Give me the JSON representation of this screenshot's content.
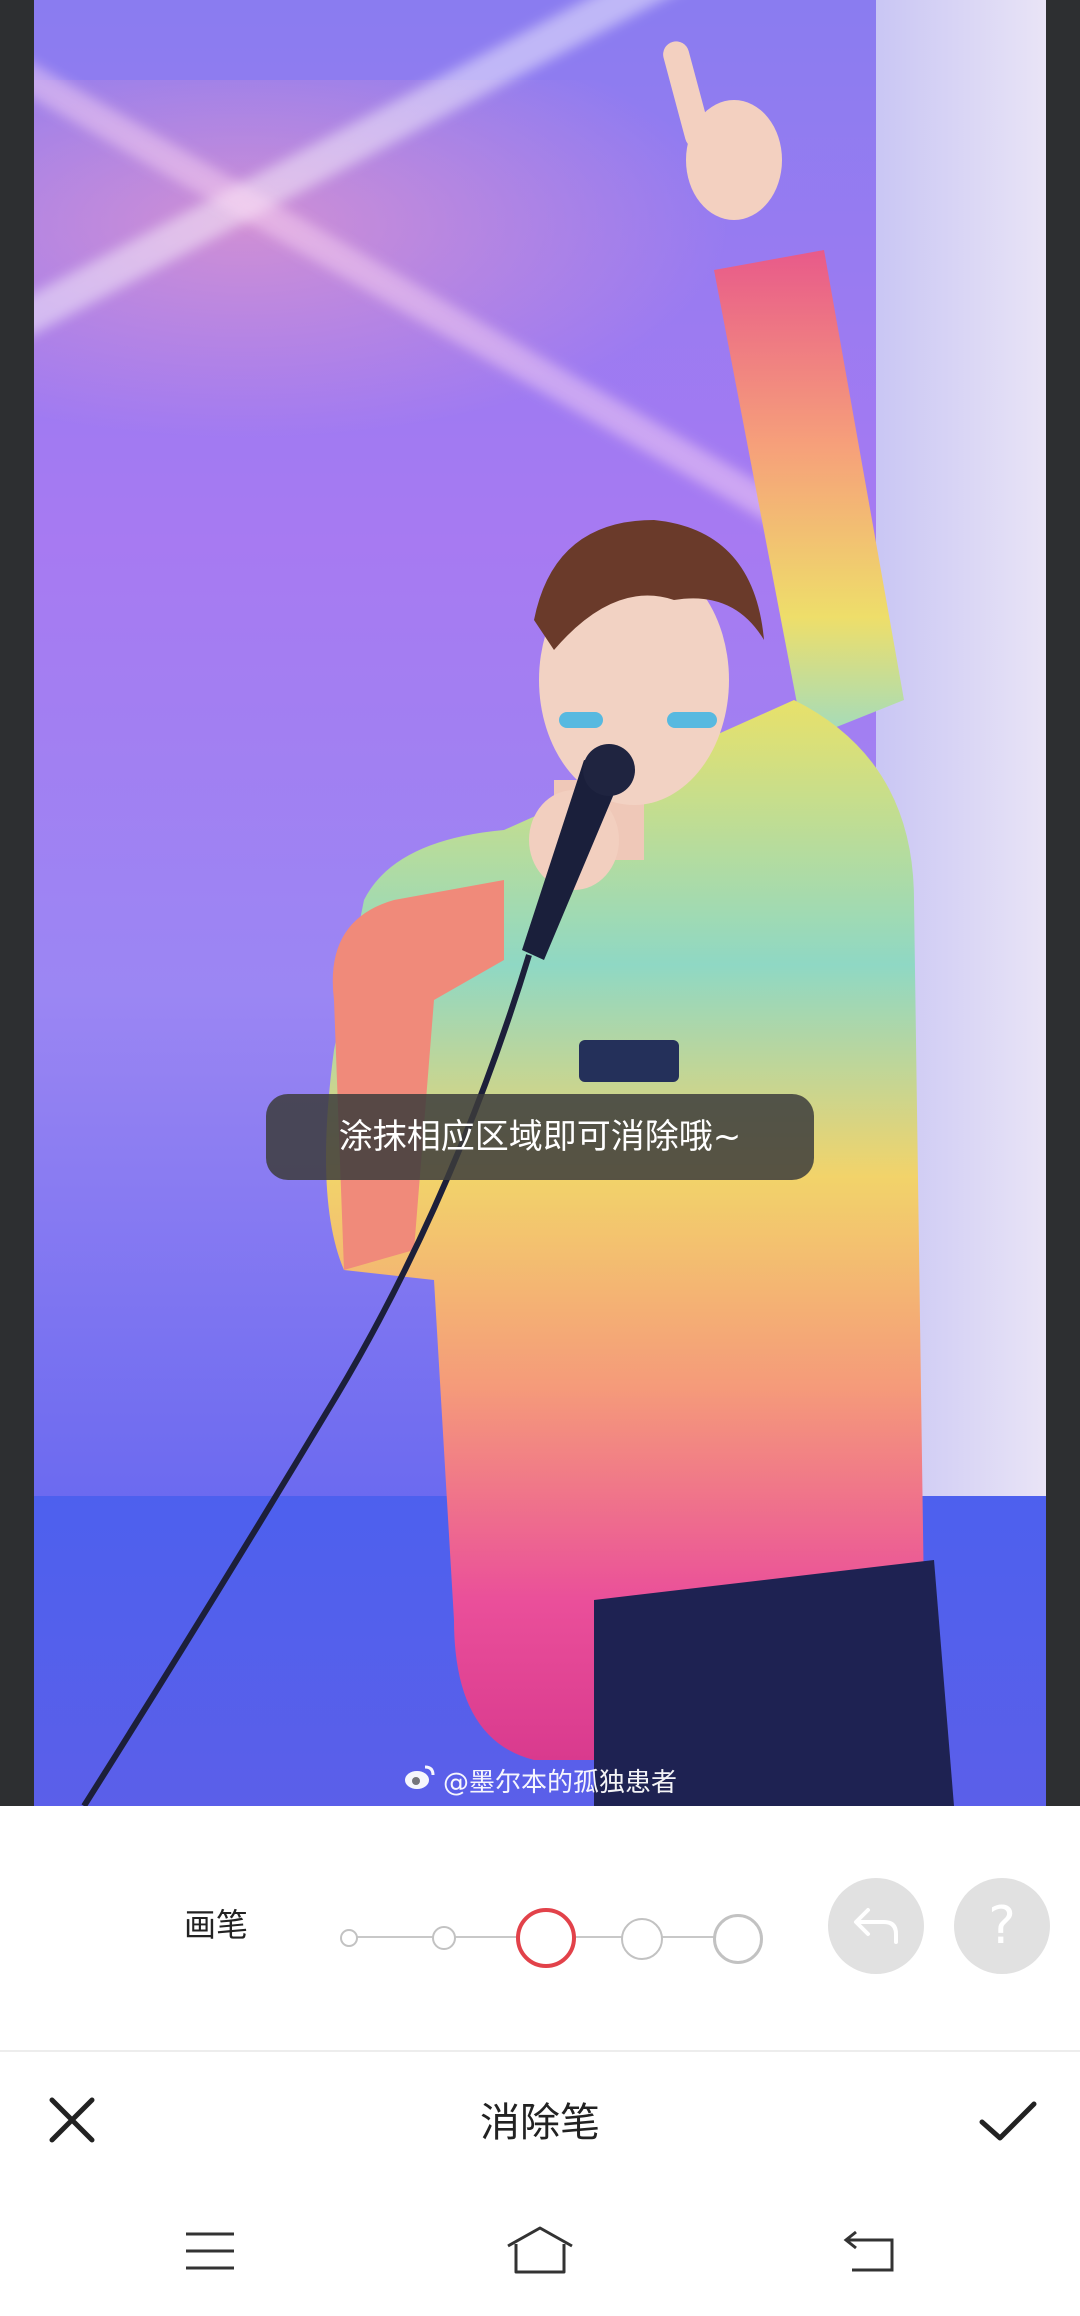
{
  "image": {
    "watermark": "@墨尔本的孤独患者",
    "tooltip": "涂抹相应区域即可消除哦~"
  },
  "toolbar": {
    "brush_label": "画笔",
    "brush_sizes": 5,
    "selected_size_index": 2,
    "undo_icon": "undo-arrow-icon",
    "help_icon": "question-mark-icon",
    "help_glyph": "?"
  },
  "actionbar": {
    "title": "消除笔",
    "cancel_icon": "close-icon",
    "confirm_icon": "checkmark-icon"
  },
  "navbar": {
    "icons": [
      "menu-icon",
      "home-icon",
      "back-icon"
    ]
  },
  "colors": {
    "accent": "#e2424a",
    "button_gray": "#e1e1e1",
    "tooltip_bg": "#3c3c3c"
  }
}
